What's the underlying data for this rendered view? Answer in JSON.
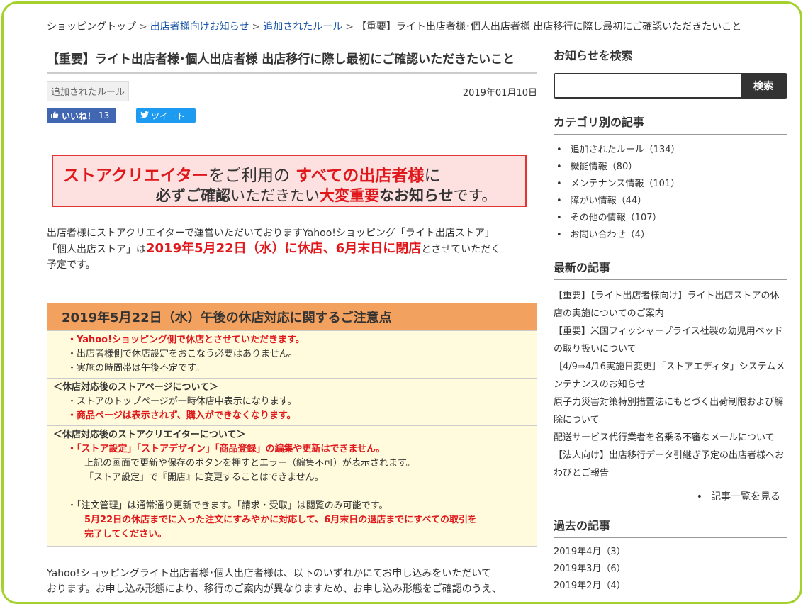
{
  "breadcrumb": {
    "home": "ショッピングトップ",
    "item1": "出店者様向けお知らせ",
    "item2": "追加されたルール",
    "current": "【重要】ライト出店者様･個人出店者様 出店移行に際し最初にご確認いただきたいこと",
    "separator": ">"
  },
  "article": {
    "title": "【重要】ライト出店者様･個人出店者様 出店移行に際し最初にご確認いただきたいこと",
    "category_tag": "追加されたルール",
    "date": "2019年01月10日",
    "like_label": "いいね！",
    "like_count": "13",
    "tweet_label": "ツイート"
  },
  "notice": {
    "l1_a": "ストアクリエイター",
    "l1_b": "をご利用の",
    "l1_c": "すべての出店者様",
    "l1_d": "に",
    "l2_a": "必ずご確認",
    "l2_b": "いただきたい",
    "l2_c": "大変重要",
    "l2_d": "なお知らせ",
    "l2_e": "です。"
  },
  "intro": {
    "p1": "出店者様にストアクリエイターで運営いただいておりますYahoo!ショッピング「ライト出店ストア」",
    "p2a": "「個人出店ストア」は",
    "p2b": "2019年5月22日（水）に休店、6月末日に閉店",
    "p2c": "とさせていただく",
    "p3": "予定です。"
  },
  "caution": {
    "heading": "2019年5月22日（水）午後の休店対応に関するご注意点",
    "s1": [
      "・Yahoo!ショッピング側で休店とさせていただきます。",
      "・出店者様側で休店設定をおこなう必要はありません。",
      "・実施の時間帯は午後不定です。"
    ],
    "s2_head": "＜休店対応後のストアページについて＞",
    "s2": [
      "・ストアのトップページが一時休店中表示になります。",
      "・商品ページは表示されず、購入ができなくなります。"
    ],
    "s3_head": "＜休店対応後のストアクリエイターについて＞",
    "s3_l1": "・「ストア設定」「ストアデザイン」「商品登録」の編集や更新はできません。",
    "s3_l2": "上記の画面で更新や保存のボタンを押すとエラー（編集不可）が表示されます。",
    "s3_l3": "「ストア設定」で『開店』に変更することはできません。",
    "s3_l4": "・「注文管理」は通常通り更新できます。「請求・受取」は閲覧のみ可能です。",
    "s3_l5": "5月22日の休店までに入った注文にすみやかに対応して、6月末日の退店までにすべての取引を",
    "s3_l6": "完了してください。"
  },
  "footer": {
    "p1": "Yahoo!ショッピングライト出店者様･個人出店者様は、以下のいずれかにてお申し込みをいただいて",
    "p2": "おります。お申し込み形態により、移行のご案内が異なりますため、お申し込み形態をご確認のうえ、"
  },
  "sidebar": {
    "search_heading": "お知らせを検索",
    "search_placeholder": "",
    "search_button": "検索",
    "category_heading": "カテゴリ別の記事",
    "categories": [
      "追加されたルール（134）",
      "機能情報（80）",
      "メンテナンス情報（101）",
      "障がい情報（44）",
      "その他の情報（107）",
      "お問い合わせ（4）"
    ],
    "recent_heading": "最新の記事",
    "recent": [
      "【重要】【ライト出店者様向け】ライト出店ストアの休店の実施についてのご案内",
      "【重要】米国フィッシャープライス社製の幼児用ベッドの取り扱いについて",
      "［4/9⇒4/16実施日変更］「ストアエディタ」システムメンテナンスのお知らせ",
      "原子力災害対策特別措置法にもとづく出荷制限および解除について",
      "配送サービス代行業者を名乗る不審なメールについて",
      "【法人向け】出店移行データ引継ぎ予定の出店者様へおわびとご報告"
    ],
    "more_label": "記事一覧を見る",
    "past_heading": "過去の記事",
    "past": [
      "2019年4月（3）",
      "2019年3月（6）",
      "2019年2月（4）"
    ]
  }
}
